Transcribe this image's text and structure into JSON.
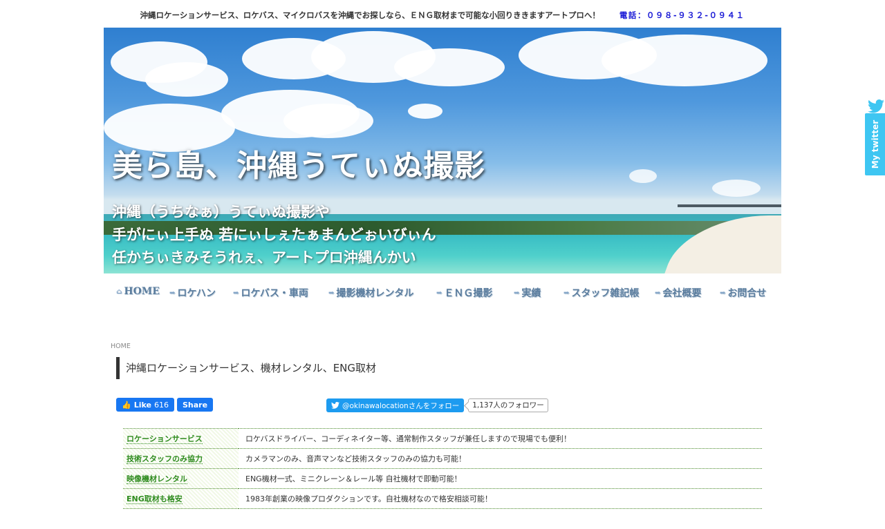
{
  "topbar": {
    "tagline": "沖縄ロケーションサービス、ロケバス、マイクロバスを沖縄でお探しなら、ＥＮＧ取材まで可能な小回りききますアートプロへ！",
    "phone": "電話：０９８-９３２-０９４１"
  },
  "hero": {
    "title": "美ら島、沖縄うてぃぬ撮影",
    "sub_lines": [
      "沖縄（うちなぁ）うてぃぬ撮影や",
      "手がにぃ上手ぬ 若にぃしぇたぁまんどぉいびぃん",
      "任かちぃきみそうれぇ、アートプロ沖縄んかい"
    ]
  },
  "nav": {
    "items": [
      {
        "label": "HOME",
        "icon": "home-icon"
      },
      {
        "label": "ロケハン",
        "icon": "arrow-icon"
      },
      {
        "label": "ロケバス・車両",
        "icon": "arrow-icon"
      },
      {
        "label": "撮影機材レンタル",
        "icon": "arrow-icon"
      },
      {
        "label": "ＥＮＧ撮影",
        "icon": "arrow-icon"
      },
      {
        "label": "実績",
        "icon": "arrow-icon"
      },
      {
        "label": "スタッフ雑記帳",
        "icon": "arrow-icon"
      },
      {
        "label": "会社概要",
        "icon": "arrow-icon"
      },
      {
        "label": "お問合せ",
        "icon": "arrow-icon"
      }
    ]
  },
  "breadcrumb": {
    "home": "HOME"
  },
  "page_title": "沖縄ロケーションサービス、機材レンタル、ENG取材",
  "social": {
    "fb_like_label": "Like",
    "fb_like_count": "616",
    "fb_share_label": "Share",
    "twitter_follow_label": "@okinawalocationさんをフォロー",
    "twitter_followers": "1,137人のフォロワー"
  },
  "services": [
    {
      "name": "ロケーションサービス",
      "desc": "ロケバスドライバー、コーディネイター等、通常制作スタッフが兼任しますので現場でも便利！"
    },
    {
      "name": "技術スタッフのみ協力",
      "desc": "カメラマンのみ、音声マンなど技術スタッフのみの協力も可能！"
    },
    {
      "name": "映像機材レンタル",
      "desc": "ENG機材一式、ミニクレーン＆レール等 自社機材で即動可能！"
    },
    {
      "name": "ENG取材も格安",
      "desc": "1983年創業の映像プロダクションです。自社機材なので格安相談可能！"
    }
  ],
  "my_twitter": {
    "label": "My twitter"
  }
}
